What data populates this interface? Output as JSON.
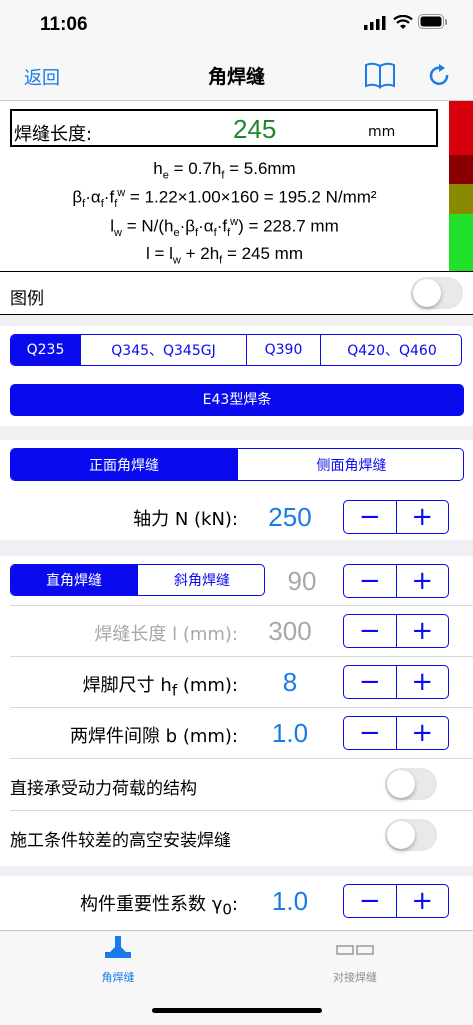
{
  "status_bar": {
    "time": "11:06"
  },
  "nav": {
    "back_label": "返回",
    "title": "角焊缝"
  },
  "result": {
    "length_label": "焊缝长度:",
    "length_value": "245",
    "length_unit": "mm",
    "formulas": [
      "h<sub>e</sub> = 0.7h<sub>f</sub> = 5.6mm",
      "β<sub>f</sub>·α<sub>f</sub>·f<sub>f</sub><sup>w</sup> = 1.22×1.00×160 = 195.2 N/mm²",
      "l<sub>w</sub> = N/(h<sub>e</sub>·β<sub>f</sub>·α<sub>f</sub>·f<sub>f</sub><sup>w</sup>) = 228.7 mm",
      "l = l<sub>w</sub> + 2h<sub>f</sub> = 245 mm"
    ],
    "side_colors": [
      "#d8000c",
      "#8a0000",
      "#8a8a00",
      "#22e12b"
    ]
  },
  "legend": {
    "label": "图例",
    "on": false
  },
  "steel": {
    "options": [
      "Q235",
      "Q345、Q345GJ",
      "Q390",
      "Q420、Q460"
    ],
    "selected": 0
  },
  "electrode": {
    "label": "E43型焊条"
  },
  "weld_type": {
    "options": [
      "正面角焊缝",
      "侧面角焊缝"
    ],
    "selected": 0
  },
  "axial": {
    "label": "轴力  N (kN):",
    "value": "250"
  },
  "angle": {
    "options": [
      "直角焊缝",
      "斜角焊缝"
    ],
    "selected": 0,
    "value": "90"
  },
  "weld_length": {
    "label": "焊缝长度  l (mm):",
    "value": "300"
  },
  "leg_size": {
    "label": "焊脚尺寸  h<sub>f</sub> (mm):",
    "value": "8"
  },
  "gap": {
    "label": "两焊件间隙  b (mm):",
    "value": "1.0"
  },
  "switches": [
    {
      "label": "直接承受动力荷载的结构",
      "on": false
    },
    {
      "label": "施工条件较差的高空安装焊缝",
      "on": false
    }
  ],
  "importance": {
    "label": "构件重要性系数  γ<sub>0</sub>:",
    "value": "1.0"
  },
  "stepper": {
    "minus": "−",
    "plus": "+"
  },
  "tabs": [
    {
      "label": "角焊缝",
      "icon": "fillet-weld-icon",
      "active": true
    },
    {
      "label": "对接焊缝",
      "icon": "butt-weld-icon",
      "active": false
    }
  ],
  "colors": {
    "accent": "#0a0aef",
    "link": "#1a7ae8",
    "result_green": "#1b8a2a"
  }
}
